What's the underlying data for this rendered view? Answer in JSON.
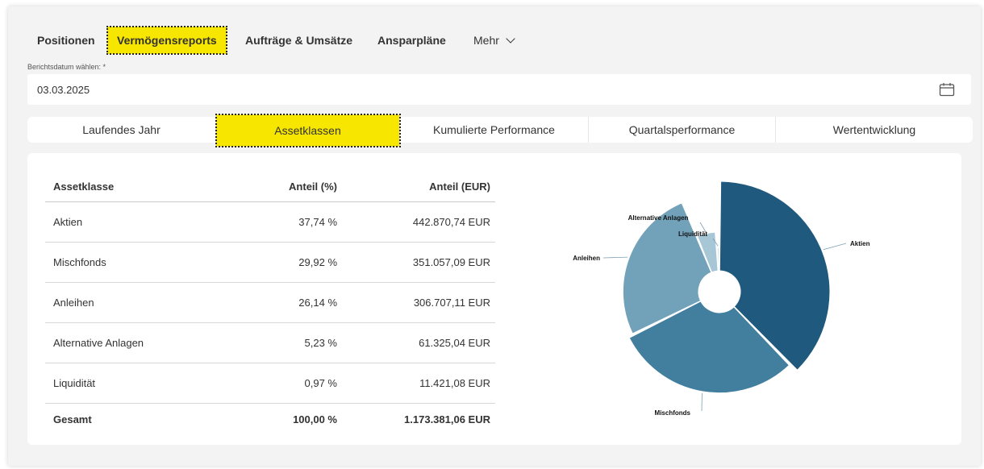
{
  "nav": {
    "items": [
      {
        "label": "Positionen"
      },
      {
        "label": "Vermögensreports"
      },
      {
        "label": "Aufträge & Umsätze"
      },
      {
        "label": "Ansparpläne"
      },
      {
        "label": "Mehr"
      }
    ],
    "active": "Vermögensreports"
  },
  "report_date": {
    "label": "Berichtsdatum wählen: *",
    "value": "03.03.2025",
    "icon": "calendar-icon"
  },
  "tabs": [
    {
      "label": "Laufendes Jahr"
    },
    {
      "label": "Assetklassen"
    },
    {
      "label": "Kumulierte Performance"
    },
    {
      "label": "Quartalsperformance"
    },
    {
      "label": "Wertentwicklung"
    }
  ],
  "active_tab": "Assetklassen",
  "table": {
    "headers": [
      "Assetklasse",
      "Anteil (%)",
      "Anteil (EUR)"
    ],
    "rows": [
      {
        "name": "Aktien",
        "pct": "37,74 %",
        "eur": "442.870,74 EUR"
      },
      {
        "name": "Mischfonds",
        "pct": "29,92 %",
        "eur": "351.057,09 EUR"
      },
      {
        "name": "Anleihen",
        "pct": "26,14 %",
        "eur": "306.707,11 EUR"
      },
      {
        "name": "Alternative Anlagen",
        "pct": "5,23 %",
        "eur": "61.325,04 EUR"
      },
      {
        "name": "Liquidität",
        "pct": "0,97 %",
        "eur": "11.421,08 EUR"
      }
    ],
    "total": {
      "name": "Gesamt",
      "pct": "100,00 %",
      "eur": "1.173.381,06 EUR"
    }
  },
  "chart_data": {
    "type": "pie",
    "labels": [
      "Aktien",
      "Mischfonds",
      "Anleihen",
      "Alternative Anlagen",
      "Liquidität"
    ],
    "values": [
      37.74,
      29.92,
      26.14,
      5.23,
      0.97
    ],
    "colors": [
      "#1f5a7e",
      "#427f9f",
      "#72a2ba",
      "#a7c6d6",
      "#cfe1ea"
    ]
  },
  "colors": {
    "accent": "#f7e600",
    "background": "#f3f3f3"
  }
}
